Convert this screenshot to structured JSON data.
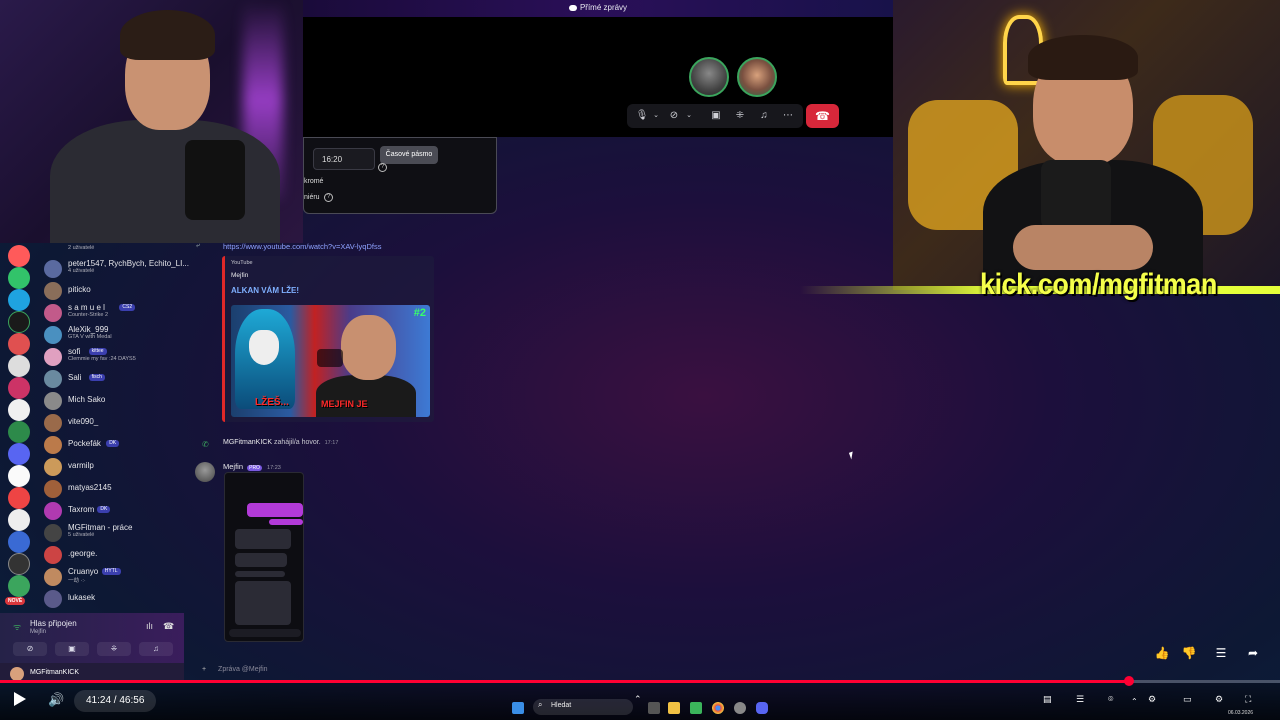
{
  "call": {
    "title": "Přímé zprávy",
    "controls": [
      "mic-icon",
      "chevron-down-icon",
      "camera-off-icon",
      "chevron-down-icon",
      "screen-share-icon",
      "activities-icon",
      "soundboard-icon",
      "more-icon"
    ],
    "hangup_color": "#d7273a"
  },
  "popup": {
    "time_value": "16:20",
    "timezone_button": "Časové pásmo",
    "fragment1": "kromé",
    "fragment2": "niéru"
  },
  "overlay": {
    "kick_text": "kick.com/mgfitman",
    "kick_color": "#e5ff3a"
  },
  "channels": [
    {
      "name": "2 uživatelé",
      "sub": "",
      "single": true,
      "badge": ""
    },
    {
      "name": "peter1547, RychBych, Echito_LI...",
      "sub": "4 uživatelé",
      "single": false,
      "badge": ""
    },
    {
      "name": "piticko",
      "sub": "",
      "single": true,
      "badge": ""
    },
    {
      "name": "s a m u e l",
      "sub": "Counter-Strike 2",
      "single": false,
      "badge": "CS2"
    },
    {
      "name": "AleXik_999",
      "sub": "GTA V with Medal",
      "single": false,
      "badge": ""
    },
    {
      "name": "sofi",
      "sub": "Clemmie my fav :24 DAYS5",
      "single": false,
      "badge": "kittee"
    },
    {
      "name": "Sali",
      "sub": "",
      "single": true,
      "badge": "fisch"
    },
    {
      "name": "Mich Sako",
      "sub": "",
      "single": true,
      "badge": ""
    },
    {
      "name": "vite090_",
      "sub": "",
      "single": true,
      "badge": ""
    },
    {
      "name": "Pockefák",
      "sub": "",
      "single": true,
      "badge": "DK"
    },
    {
      "name": "varmilp",
      "sub": "",
      "single": true,
      "badge": ""
    },
    {
      "name": "matyas2145",
      "sub": "",
      "single": true,
      "badge": ""
    },
    {
      "name": "Taxrom",
      "sub": "",
      "single": true,
      "badge": "DK"
    },
    {
      "name": "MGFitman - práce",
      "sub": "5 uživatelé",
      "single": false,
      "badge": ""
    },
    {
      "name": ".george.",
      "sub": "",
      "single": true,
      "badge": ""
    },
    {
      "name": "Cruanyo",
      "sub": "一劫 ·:·",
      "single": false,
      "badge": "HYTL"
    },
    {
      "name": "lukasek",
      "sub": "",
      "single": true,
      "badge": ""
    }
  ],
  "rail": {
    "new_label": "NOVÉ"
  },
  "voice": {
    "status": "Hlas připojen",
    "channel": "Mejfin"
  },
  "user": {
    "name": "MGFitmanKICK"
  },
  "chat": {
    "link": "https://www.youtube.com/watch?v=XAV-lyqDfss",
    "embed": {
      "provider": "YouTube",
      "author": "Mejfin",
      "title": "ALKAN VÁM LŽE!",
      "thumb_left_text": "LŽEŠ...",
      "thumb_right_text": "MEJFIN JE",
      "thumb_num": "#2"
    },
    "system": {
      "user": "MGFitmanKICK",
      "action": "zahájil/a hovor.",
      "time": "17:17"
    },
    "message": {
      "author": "Mejfin",
      "badge": "PRO",
      "time": "17:23"
    },
    "composer_placeholder": "Zpráva @Mejfin"
  },
  "player": {
    "current_time": "41:24",
    "duration": "46:56",
    "time_text": "41:24 / 46:56",
    "progress": 0.882,
    "accent": "#ff0033"
  },
  "taskbar": {
    "search_placeholder": "Hledat",
    "date": "06.03.2026"
  }
}
